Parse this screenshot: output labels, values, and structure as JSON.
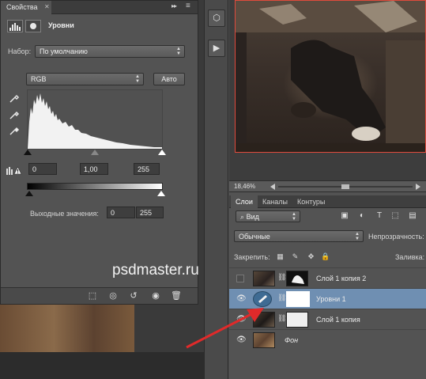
{
  "properties_panel": {
    "tab_label": "Свойства",
    "header_title": "Уровни",
    "preset_label": "Набор:",
    "preset_value": "По умолчанию",
    "channel_value": "RGB",
    "auto_button": "Авто",
    "input_black": "0",
    "input_gamma": "1,00",
    "input_white": "255",
    "output_label": "Выходные значения:",
    "output_black": "0",
    "output_white": "255"
  },
  "document": {
    "zoom": "18,46%"
  },
  "layers_panel": {
    "tabs": [
      {
        "label": "Слои",
        "active": true
      },
      {
        "label": "Каналы",
        "active": false
      },
      {
        "label": "Контуры",
        "active": false
      }
    ],
    "filter_value": "Вид",
    "blend_mode": "Обычные",
    "opacity_label": "Непрозрачность:",
    "lock_label": "Закрепить:",
    "fill_label": "Заливка:",
    "layers": [
      {
        "name": "Слой 1 копия 2",
        "visible": false,
        "selected": false
      },
      {
        "name": "Уровни 1",
        "visible": true,
        "selected": true
      },
      {
        "name": "Слой 1 копия",
        "visible": true,
        "selected": false
      },
      {
        "name": "Фон",
        "visible": true,
        "selected": false
      }
    ]
  },
  "watermark": "psdmaster.ru",
  "colors": {
    "panel": "#535353",
    "selection": "#6f8fb2",
    "canvas_border": "#e04a3c",
    "annotation_arrow": "#e02a2a"
  }
}
